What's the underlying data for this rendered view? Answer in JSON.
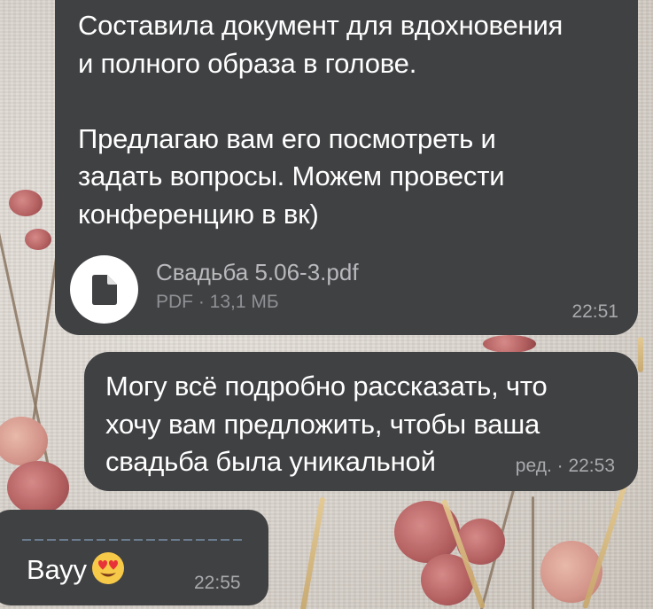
{
  "messages": [
    {
      "text": "Составила документ для вдохновения\nи полного образа в голове.\n\nПредлагаю вам его посмотреть и\nзадать вопросы. Можем провести\nконференцию в вк)",
      "attachment": {
        "name": "Свадьба 5.06-3.pdf",
        "info": "PDF · 13,1 МБ",
        "icon": "document-icon"
      },
      "time": "22:51"
    },
    {
      "text": "Могу всё подробно рассказать, что\nхочу вам предложить, чтобы ваша\nсвадьба была уникальной",
      "edited": "ред. · 22:53"
    },
    {
      "text": "Вауу",
      "emoji": "heart-eyes-emoji",
      "time": "22:55"
    }
  ],
  "colors": {
    "bubble": "#404143",
    "time": "#a9aaad",
    "file_name": "#b9b9bd"
  }
}
